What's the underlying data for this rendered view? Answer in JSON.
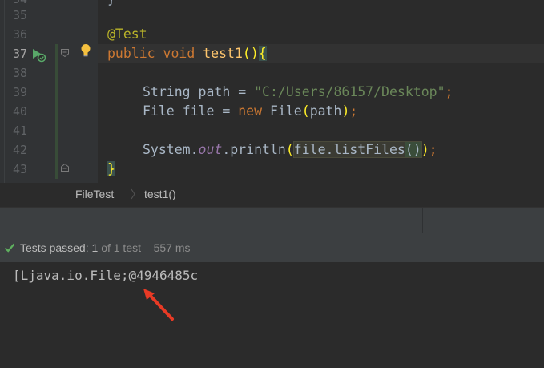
{
  "editor": {
    "lines": [
      {
        "num": "34",
        "text": "}"
      },
      {
        "num": "35",
        "text": ""
      },
      {
        "num": "36",
        "annotation": "@Test"
      },
      {
        "num": "37",
        "kw1": "public",
        "kw2": "void",
        "method": "test1",
        "parens": "()",
        "brace": "{"
      },
      {
        "num": "38",
        "text": ""
      },
      {
        "num": "39",
        "type": "String",
        "var": "path",
        "eq": "=",
        "string": "\"C:/Users/86157/Desktop\"",
        "semi": ";"
      },
      {
        "num": "40",
        "type": "File",
        "var": "file",
        "eq": "=",
        "kw": "new",
        "ctor": "File",
        "args": "path",
        "semi": ";"
      },
      {
        "num": "41",
        "text": ""
      },
      {
        "num": "42",
        "obj": "System.",
        "field": "out",
        "call": ".println",
        "expr": "file.listFiles",
        "inner_parens": "()",
        "semi": ";"
      },
      {
        "num": "43",
        "brace": "}"
      }
    ]
  },
  "breadcrumb": {
    "class_name": "FileTest",
    "method_name": "test1()"
  },
  "run": {
    "status_label": "Tests passed:",
    "passed": "1",
    "of_text": "of 1 test",
    "duration": "557 ms",
    "dash": "–"
  },
  "console": {
    "output": "[Ljava.io.File;@4946485c"
  },
  "colors": {
    "success": "#5fb05f",
    "annotation_arrow": "#e83a25"
  }
}
